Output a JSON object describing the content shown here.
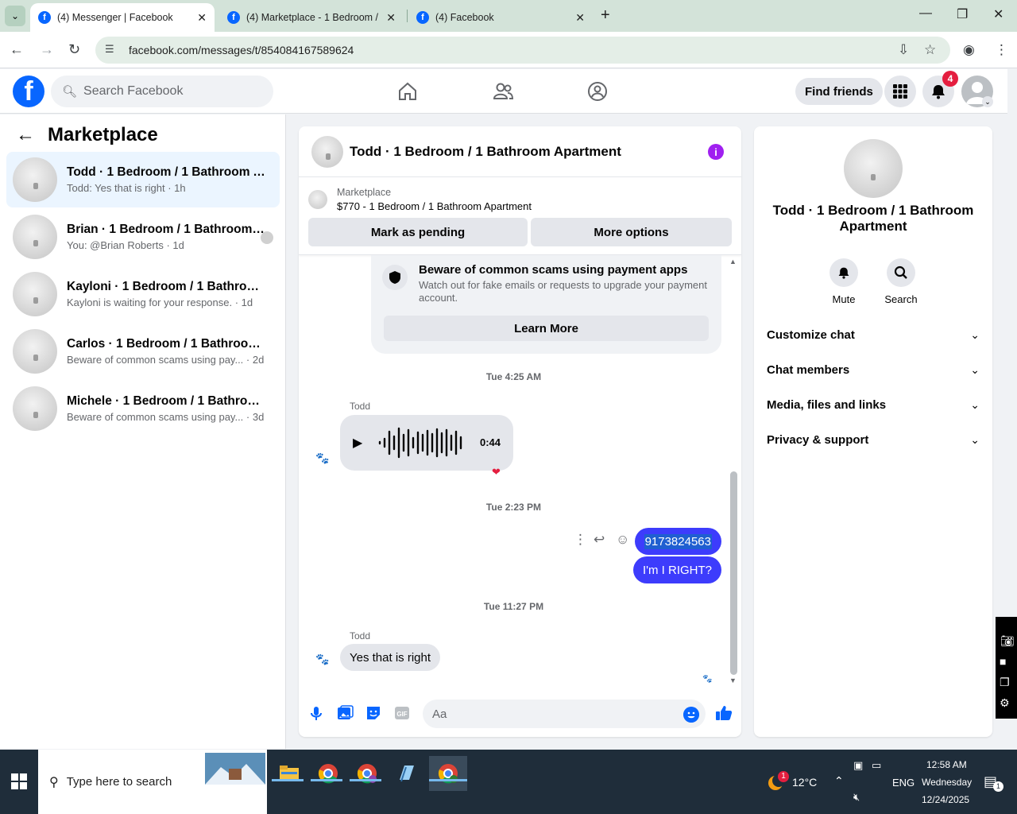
{
  "browser": {
    "tabs": [
      {
        "title": "(4) Messenger | Facebook",
        "close": "✕"
      },
      {
        "title": "(4) Marketplace - 1 Bedroom /",
        "close": "✕"
      },
      {
        "title": "(4) Facebook",
        "close": "✕"
      }
    ],
    "url": "facebook.com/messages/t/854084167589624"
  },
  "fb": {
    "search_placeholder": "Search Facebook",
    "find_friends": "Find friends",
    "notif_count": "4"
  },
  "sidebar": {
    "title": "Marketplace",
    "conversations": [
      {
        "name": "Todd · 1 Bedroom / 1 Bathroom Ap...",
        "sub": "Todd: Yes that is right · 1h"
      },
      {
        "name": "Brian · 1 Bedroom / 1 Bathroom ...",
        "sub": "You: @Brian Roberts · 1d"
      },
      {
        "name": "Kayloni · 1 Bedroom / 1 Bathroom ...",
        "sub": "Kayloni is waiting for your response. · 1d"
      },
      {
        "name": "Carlos · 1 Bedroom / 1 Bathroom A...",
        "sub": "Beware of common scams using pay... · 2d"
      },
      {
        "name": "Michele · 1 Bedroom / 1 Bathroom ...",
        "sub": "Beware of common scams using pay... · 3d"
      }
    ]
  },
  "chat": {
    "title": "Todd · 1 Bedroom / 1 Bathroom Apartment",
    "marketplace_label": "Marketplace",
    "listing": "$770 - 1 Bedroom / 1 Bathroom Apartment",
    "mark_pending": "Mark as pending",
    "more_options": "More options",
    "scam_title": "Beware of common scams using payment apps",
    "scam_desc": "Watch out for fake emails or requests to upgrade your payment account.",
    "learn_more": "Learn More",
    "time1": "Tue 4:25 AM",
    "sender1": "Todd",
    "audio_duration": "0:44",
    "time2": "Tue 2:23 PM",
    "out_msg1": "9173824563",
    "out_msg2": "I'm I RIGHT?",
    "time3": "Tue 11:27 PM",
    "sender2": "Todd",
    "in_msg": "Yes that is right",
    "composer_placeholder": "Aa"
  },
  "info": {
    "name": "Todd · 1 Bedroom / 1 Bathroom Apartment",
    "mute": "Mute",
    "search": "Search",
    "sections": [
      "Customize chat",
      "Chat members",
      "Media, files and links",
      "Privacy & support"
    ]
  },
  "taskbar": {
    "search_placeholder": "Type here to search",
    "temp": "12°C",
    "lang": "ENG",
    "time": "12:58 AM",
    "day": "Wednesday",
    "date": "12/24/2025",
    "weather_badge": "1",
    "notif_badge": "1"
  }
}
